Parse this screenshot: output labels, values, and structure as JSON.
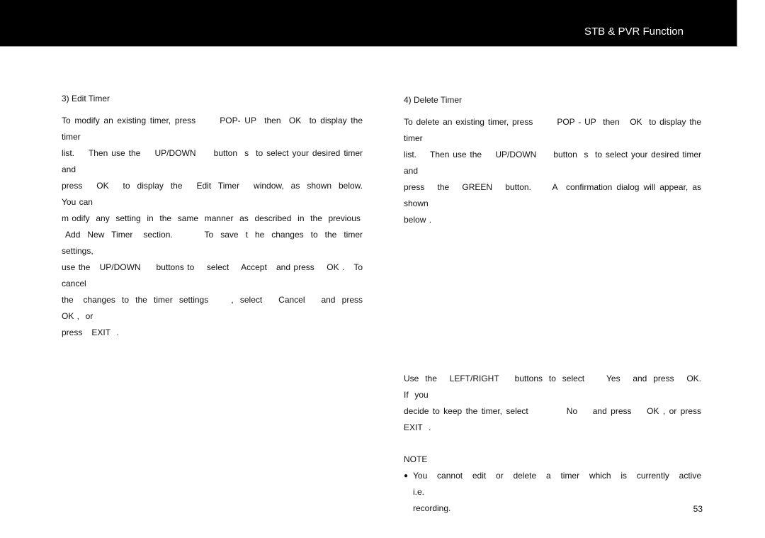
{
  "header": {
    "title": "STB & PVR Function"
  },
  "edit_timer": {
    "heading": "3)  Edit Timer",
    "lines": [
      "To modify an existing timer, press      POP- UP  then  OK  to display the timer",
      "list.    Then use the    UP/DOWN     button  s  to select your desired timer and",
      "press  OK  to display the  Edit Timer  window, as shown below.              You can",
      "m odify  any  setting  in  the  same  manner  as  described  in  the  previous",
      " Add  New  Timer   section.         To  save  t  he  changes  to  the  timer  settings,",
      "use the   UP/DOWN     buttons to    select    Accept   and press    OK .   To cancel",
      "the   changes  to  the  timer  settings       ,  select     Cancel     and  press    OK ,  or",
      "press   EXIT  ."
    ]
  },
  "delete_timer": {
    "heading": "4)  Delete Timer",
    "lines": [
      "To delete an existing timer, press       POP - UP  then   OK  to display the timer",
      "list.    Then use the    UP/DOWN     button  s  to select your desired timer and",
      "press   the   GREEN   button.     A  confirmation dialog will appear, as shown",
      "below ."
    ],
    "after_lines": [
      "Use  the    LEFT/RIGHT     buttons  to  select       Yes    and  press    OK.    If  you",
      "decide to keep the timer, select          No    and press    OK , or press    EXIT  ."
    ]
  },
  "note": {
    "title": "NOTE",
    "bullet_icon": "bullet-dot",
    "items": [
      "You   cannot   edit   or   delete   a   timer   which   is   currently   active   i.e.\nrecording."
    ]
  },
  "page_number": "53"
}
